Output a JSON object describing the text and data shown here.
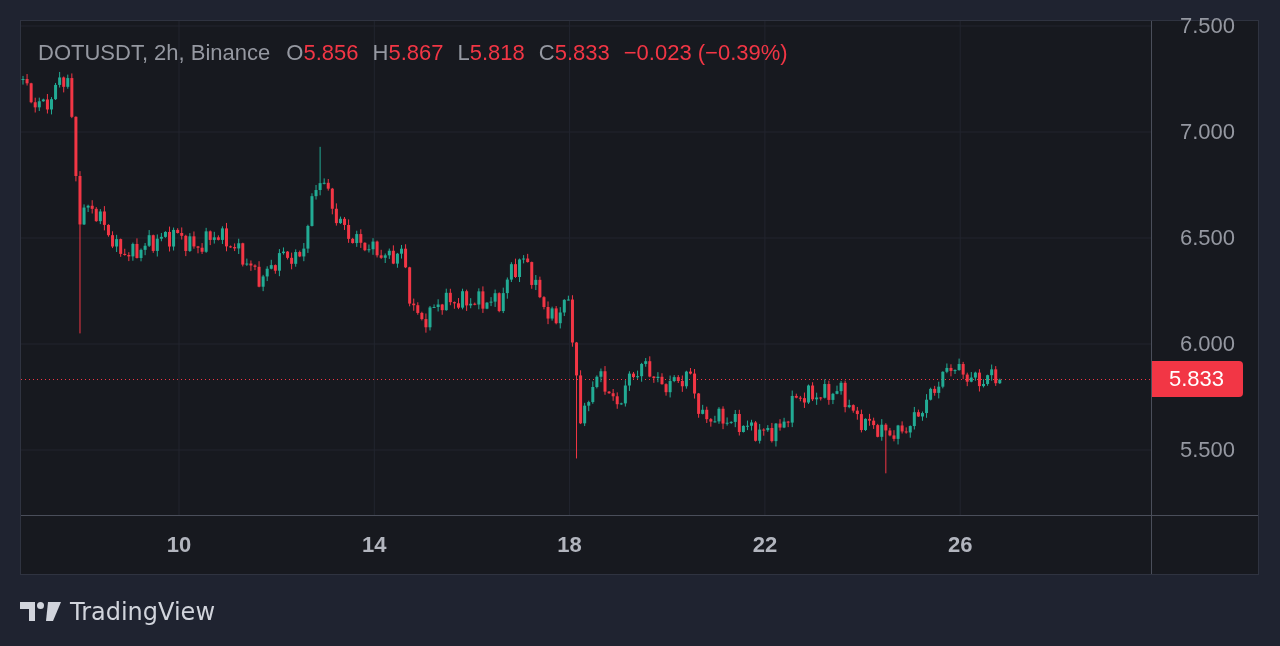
{
  "legend": {
    "symbol": "DOTUSDT, 2h, Binance",
    "falling": true,
    "values": [
      {
        "label": "O",
        "value": "5.856"
      },
      {
        "label": "H",
        "value": "5.867"
      },
      {
        "label": "L",
        "value": "5.818"
      },
      {
        "label": "C",
        "value": "5.833"
      }
    ],
    "change": "−0.023 (−0.39%)"
  },
  "price_axis": {
    "labels": [
      "7.500",
      "7.000",
      "6.500",
      "6.000",
      "5.500"
    ]
  },
  "last_price": {
    "label": "5.833",
    "falling": true
  },
  "time_axis": {
    "labels": [
      "10",
      "14",
      "18",
      "22",
      "26"
    ]
  },
  "branding": {
    "name": "TradingView"
  }
}
